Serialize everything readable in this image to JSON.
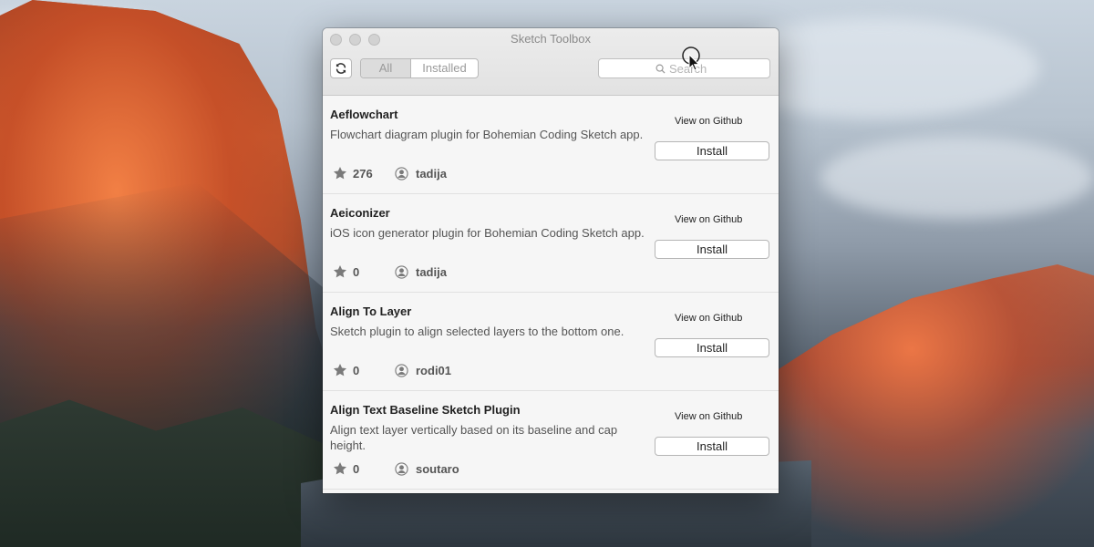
{
  "window": {
    "title": "Sketch Toolbox"
  },
  "toolbar": {
    "tabs": [
      "All",
      "Installed"
    ],
    "active_tab": "All",
    "search": {
      "placeholder": "Search",
      "value": ""
    }
  },
  "plugins": [
    {
      "name": "Aeflowchart",
      "description": "Flowchart diagram plugin for Bohemian Coding Sketch app.",
      "stars": "276",
      "author": "tadija",
      "github_label": "View on Github",
      "install_label": "Install"
    },
    {
      "name": "Aeiconizer",
      "description": "iOS icon generator plugin for Bohemian Coding Sketch app.",
      "stars": "0",
      "author": "tadija",
      "github_label": "View on Github",
      "install_label": "Install"
    },
    {
      "name": "Align To Layer",
      "description": "Sketch plugin to align selected layers to the bottom one.",
      "stars": "0",
      "author": "rodi01",
      "github_label": "View on Github",
      "install_label": "Install"
    },
    {
      "name": "Align Text Baseline Sketch Plugin",
      "description": "Align text layer vertically based on its baseline and cap height.",
      "stars": "0",
      "author": "soutaro",
      "github_label": "View on Github",
      "install_label": "Install"
    }
  ],
  "icons": {
    "refresh": "refresh-icon",
    "search": "search-icon",
    "star": "star-icon",
    "author": "user-icon",
    "cursor": "cursor-icon"
  }
}
